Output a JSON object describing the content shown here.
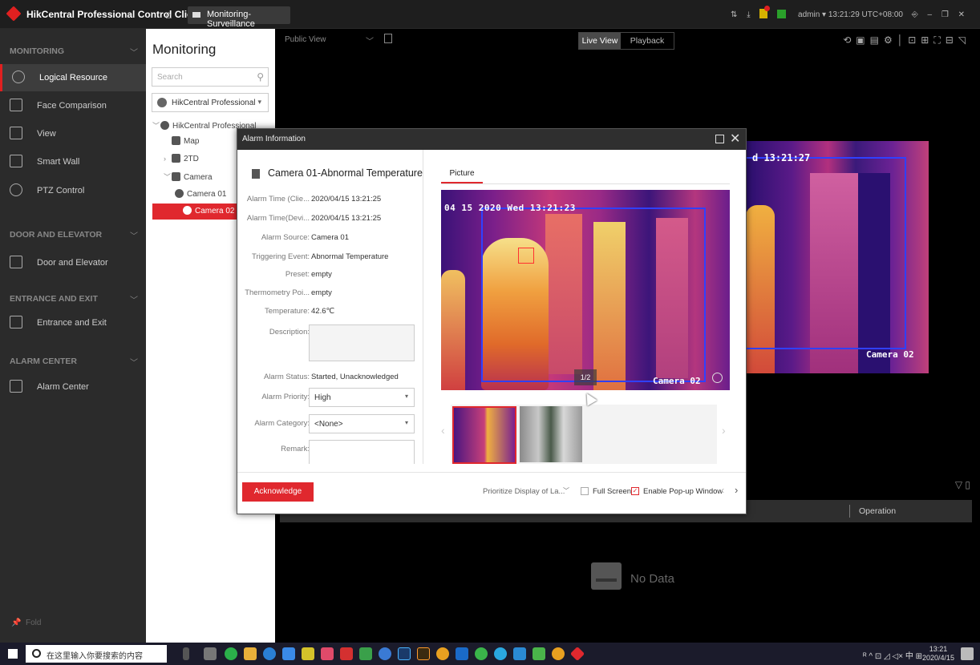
{
  "titlebar": {
    "app_title": "HikCentral Professional Control Client",
    "tab_label": "Monitoring-Surveillance",
    "user_status": "admin ▾  13:21:29 UTC+08:00"
  },
  "nav": {
    "sections": [
      {
        "title": "MONITORING"
      },
      {
        "title": "DOOR AND ELEVATOR"
      },
      {
        "title": "ENTRANCE AND EXIT"
      },
      {
        "title": "ALARM CENTER"
      }
    ],
    "items": [
      {
        "label": "Logical Resource",
        "icon": "globe-icon",
        "active": true
      },
      {
        "label": "Face Comparison",
        "icon": "face-icon"
      },
      {
        "label": "View",
        "icon": "view-icon"
      },
      {
        "label": "Smart Wall",
        "icon": "smart-wall-icon"
      },
      {
        "label": "PTZ Control",
        "icon": "ptz-icon"
      },
      {
        "label": "Door and Elevator",
        "icon": "door-icon"
      },
      {
        "label": "Entrance and Exit",
        "icon": "barrier-icon"
      },
      {
        "label": "Alarm Center",
        "icon": "bell-icon"
      }
    ],
    "fold": "Fold"
  },
  "resource": {
    "title": "Monitoring",
    "search_placeholder": "Search",
    "site": "HikCentral Professional",
    "tree": [
      {
        "label": "HikCentral Professional"
      },
      {
        "label": "Map"
      },
      {
        "label": "2TD"
      },
      {
        "label": "Camera"
      },
      {
        "label": "Camera 01"
      },
      {
        "label": "Camera 02",
        "selected": true
      }
    ]
  },
  "main": {
    "view_name": "Public View",
    "mode_live": "Live View",
    "mode_playback": "Playback",
    "bg_timestamp": "d 13:21:27",
    "bg_camera_label": "Camera 02",
    "list_operation": "Operation",
    "no_data": "No Data"
  },
  "dialog": {
    "title": "Alarm Information",
    "alarm_title": "Camera 01-Abnormal Temperature",
    "fields": [
      {
        "label": "Alarm Time (Clie...",
        "value": "2020/04/15 13:21:25"
      },
      {
        "label": "Alarm Time(Devi...",
        "value": "2020/04/15 13:21:25"
      },
      {
        "label": "Alarm Source:",
        "value": "Camera 01"
      },
      {
        "label": "Triggering Event:",
        "value": "Abnormal Temperature"
      },
      {
        "label": "Preset:",
        "value": "empty"
      },
      {
        "label": "Thermometry Poi...",
        "value": "empty"
      },
      {
        "label": "Temperature:",
        "value": "42.6℃"
      }
    ],
    "description_label": "Description:",
    "status_label": "Alarm Status:",
    "status_value": "Started, Unacknowledged",
    "priority_label": "Alarm Priority:",
    "priority_value": "High",
    "category_label": "Alarm Category:",
    "category_value": "<None>",
    "remark_label": "Remark:",
    "picture_tab": "Picture",
    "pic_timestamp": "04 15 2020 Wed 13:21:23",
    "pic_camera_label": "Camera 02",
    "pic_counter": "1/2",
    "ack_label": "Acknowledge",
    "prioritize_label": "Prioritize Display of La...",
    "fullscreen_label": "Full Screen",
    "popup_label": "Enable Pop-up Window"
  },
  "taskbar": {
    "search_placeholder": "在这里输入你要搜索的内容",
    "time": "13:21",
    "date": "2020/4/15",
    "tray": "ᴿ  ^  ⊡  ◿  ◁×  中  ⊞"
  },
  "colors": {
    "accent": "#e0282e",
    "nav_bg": "#2b2b2b",
    "main_bg": "#000000"
  }
}
